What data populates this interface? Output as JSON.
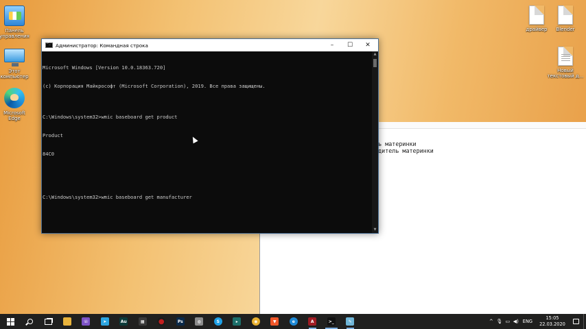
{
  "desktop": {
    "icons_left": [
      {
        "label": "Панель\nуправления",
        "icon": "control-panel-icon"
      },
      {
        "label": "Этот\nкомпьютер",
        "icon": "this-pc-icon"
      },
      {
        "label": "Microsoft\nEdge",
        "icon": "edge-icon"
      }
    ],
    "icons_right": [
      {
        "label": "драйвер",
        "icon": "file-icon"
      },
      {
        "label": "Blender",
        "icon": "file-icon"
      },
      {
        "label": "Новый\nтекстовый д...",
        "icon": "text-document-icon"
      }
    ]
  },
  "cmd": {
    "title": "Администратор: Командная строка",
    "controls": {
      "minimize": "–",
      "maximize": "☐",
      "close": "✕"
    },
    "lines": [
      "Microsoft Windows [Version 10.0.18363.720]",
      "(c) Корпорация Майкрософт (Microsoft Corporation), 2019. Все права защищены.",
      "",
      "C:\\Windows\\system32>wmic baseboard get product",
      "Product",
      "84C0",
      "",
      "",
      "C:\\Windows\\system32>wmic baseboard get manufacturer"
    ]
  },
  "notepad": {
    "lines": [
      "дель материнки",
      "зводитель материнки"
    ]
  },
  "taskbar": {
    "apps": [
      {
        "name": "file-explorer",
        "icon": "folder-icon",
        "color": "#e8b33c",
        "glyph": ""
      },
      {
        "name": "viber",
        "icon": "viber-icon",
        "color": "#7d53c6",
        "glyph": "☏"
      },
      {
        "name": "telegram",
        "icon": "telegram-icon",
        "color": "#2ca5e0",
        "glyph": "➤"
      },
      {
        "name": "audition",
        "icon": "audition-icon",
        "color": "#0c3b3a",
        "glyph": "Au"
      },
      {
        "name": "video-editor",
        "icon": "film-icon",
        "color": "#3a3a3a",
        "glyph": "▦"
      },
      {
        "name": "recorder",
        "icon": "record-icon",
        "color": "#c21f1f",
        "glyph": "●"
      },
      {
        "name": "photoshop",
        "icon": "photoshop-icon",
        "color": "#0b2a4a",
        "glyph": "Ps"
      },
      {
        "name": "network-tool",
        "icon": "globe-icon",
        "color": "#8c8c8c",
        "glyph": "◍"
      },
      {
        "name": "skype",
        "icon": "skype-icon",
        "color": "#1ea0e6",
        "glyph": "S"
      },
      {
        "name": "media-player",
        "icon": "player-icon",
        "color": "#1d6f6a",
        "glyph": "▸"
      },
      {
        "name": "chrome",
        "icon": "chrome-icon",
        "color": "#e8b02f",
        "glyph": "◉"
      },
      {
        "name": "brave",
        "icon": "brave-icon",
        "color": "#f0572a",
        "glyph": "▼"
      },
      {
        "name": "edge",
        "icon": "edge-icon",
        "color": "#1f8ad6",
        "glyph": "e"
      },
      {
        "name": "app-red",
        "icon": "app-icon",
        "color": "#a01c24",
        "glyph": "A"
      },
      {
        "name": "command-prompt",
        "icon": "cmd-icon",
        "color": "#111111",
        "glyph": ">_"
      },
      {
        "name": "notepad",
        "icon": "notepad-icon",
        "color": "#6fb6d8",
        "glyph": "✎"
      }
    ],
    "tray": {
      "chevron": "^",
      "mic": "🎙",
      "network": "▭",
      "volume": "◀)",
      "language": "ENG",
      "time": "15:05",
      "date": "22.03.2020"
    }
  }
}
